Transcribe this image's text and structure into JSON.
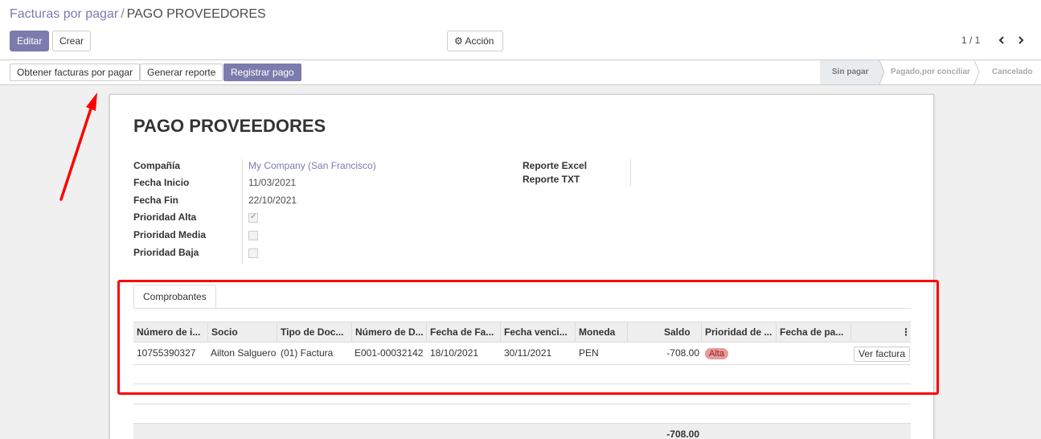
{
  "breadcrumb": {
    "parent": "Facturas por pagar",
    "separator": "/",
    "current": "PAGO PROVEEDORES"
  },
  "toolbar": {
    "edit_label": "Editar",
    "create_label": "Crear",
    "action_label": "Acción",
    "pager": "1 / 1"
  },
  "statusbar": {
    "buttons": [
      "Obtener facturas por pagar",
      "Generar reporte",
      "Registrar pago"
    ],
    "stages": [
      "Sin pagar",
      "Pagado,por conciliar",
      "Cancelado"
    ],
    "current_stage": "Sin pagar"
  },
  "form": {
    "title": "PAGO PROVEEDORES",
    "fields": {
      "company_label": "Compañía",
      "company_value": "My Company (San Francisco)",
      "start_label": "Fecha Inicio",
      "start_value": "11/03/2021",
      "end_label": "Fecha Fin",
      "end_value": "22/10/2021",
      "high_label": "Prioridad Alta",
      "high_checked": true,
      "medium_label": "Prioridad Media",
      "medium_checked": false,
      "low_label": "Prioridad Baja",
      "low_checked": false,
      "excel_label": "Reporte Excel",
      "txt_label": "Reporte TXT"
    }
  },
  "tab": {
    "label": "Comprobantes"
  },
  "table": {
    "headers": [
      "Número de i...",
      "Socio",
      "Tipo de Doc...",
      "Número de D...",
      "Fecha de Fa...",
      "Fecha venci...",
      "Moneda",
      "Saldo",
      "Prioridad de ...",
      "Fecha de pa...",
      "⋮"
    ],
    "rows": [
      {
        "numero": "10755390327",
        "socio": "Ailton Salguero",
        "tipo": "(01) Factura",
        "numero_doc": "E001-00032142",
        "fecha_factura": "18/10/2021",
        "fecha_venc": "30/11/2021",
        "moneda": "PEN",
        "saldo": "-708.00",
        "prioridad": "Alta",
        "fecha_pago": "",
        "action": "Ver factura"
      }
    ],
    "total": "-708.00"
  },
  "colors": {
    "primary": "#7c7bad",
    "annotation": "#ff0000",
    "badge_bg": "#e89a9a"
  }
}
